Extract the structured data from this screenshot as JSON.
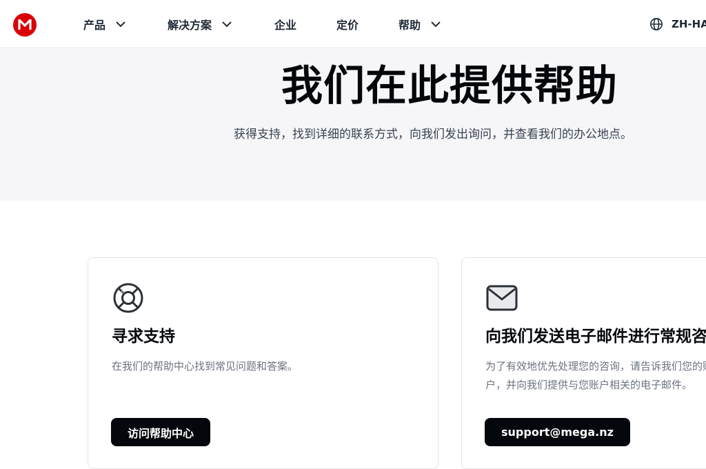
{
  "header": {
    "logo_letter": "M",
    "nav": [
      {
        "label": "产品",
        "has_dropdown": true
      },
      {
        "label": "解决方案",
        "has_dropdown": true
      },
      {
        "label": "企业",
        "has_dropdown": false
      },
      {
        "label": "定价",
        "has_dropdown": false
      },
      {
        "label": "帮助",
        "has_dropdown": true
      }
    ],
    "language": "ZH-HANS"
  },
  "hero": {
    "title": "我们在此提供帮助",
    "subtitle": "获得支持，找到详细的联系方式，向我们发出询问，并查看我们的办公地点。"
  },
  "cards": [
    {
      "icon": "lifebuoy-icon",
      "title": "寻求支持",
      "description": "在我们的帮助中心找到常见问题和答案。",
      "button": "访问帮助中心"
    },
    {
      "icon": "envelope-icon",
      "title": "向我们发送电子邮件进行常规咨询",
      "description": "为了有效地优先处理您的咨询，请告诉我们您的账户，并向我们提供与您账户相关的电子邮件。",
      "button": "support@mega.nz"
    }
  ],
  "colors": {
    "brand": "#d90007",
    "button_bg": "#04070c",
    "hero_bg": "#f6f6f8"
  }
}
